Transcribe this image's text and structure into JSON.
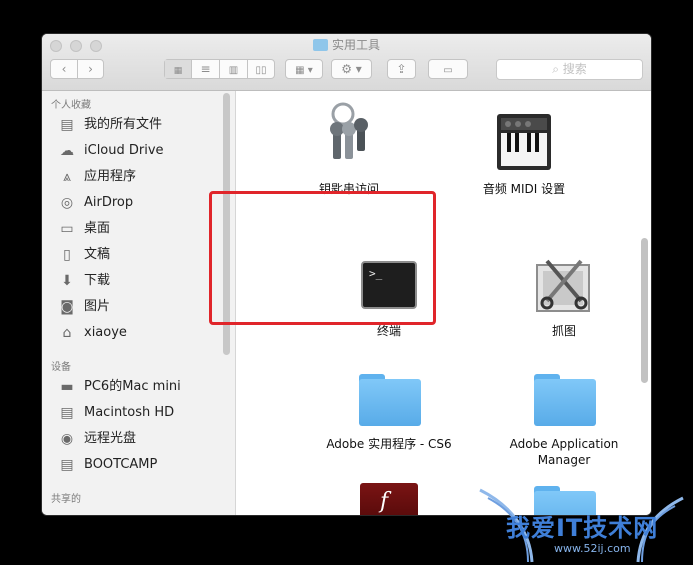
{
  "window": {
    "title": "实用工具"
  },
  "toolbar": {
    "search_placeholder": "搜索"
  },
  "sidebar": {
    "favorites_header": "个人收藏",
    "favorites": [
      {
        "label": "我的所有文件",
        "icon": "all-files-icon"
      },
      {
        "label": "iCloud Drive",
        "icon": "cloud-icon"
      },
      {
        "label": "应用程序",
        "icon": "applications-icon"
      },
      {
        "label": "AirDrop",
        "icon": "airdrop-icon"
      },
      {
        "label": "桌面",
        "icon": "desktop-icon"
      },
      {
        "label": "文稿",
        "icon": "documents-icon"
      },
      {
        "label": "下载",
        "icon": "download-icon"
      },
      {
        "label": "图片",
        "icon": "camera-icon"
      },
      {
        "label": "xiaoye",
        "icon": "home-icon"
      }
    ],
    "devices_header": "设备",
    "devices": [
      {
        "label": "PC6的Mac mini",
        "icon": "computer-icon"
      },
      {
        "label": "Macintosh HD",
        "icon": "disk-icon"
      },
      {
        "label": "远程光盘",
        "icon": "optical-disc-icon"
      },
      {
        "label": "BOOTCAMP",
        "icon": "disk-icon"
      }
    ],
    "shared_header": "共享的"
  },
  "files": [
    {
      "label": "钥匙串访问",
      "icon": "keychain-icon"
    },
    {
      "label": "音频 MIDI 设置",
      "icon": "midi-keyboard-icon"
    },
    {
      "label": "终端",
      "icon": "terminal-icon"
    },
    {
      "label": "抓图",
      "icon": "grab-icon"
    },
    {
      "label": "Adobe 实用程序 - CS6",
      "icon": "folder-icon"
    },
    {
      "label": "Adobe Application Manager",
      "icon": "folder-icon"
    },
    {
      "label": "",
      "icon": "flash-icon"
    },
    {
      "label": "",
      "icon": "folder-icon"
    }
  ],
  "terminal_prompt": ">_",
  "watermark": {
    "title": "我爱IT技术网",
    "url": "www.52ij.com"
  },
  "colors": {
    "highlight": "#e0252a",
    "folder": "#6bbcf4"
  }
}
